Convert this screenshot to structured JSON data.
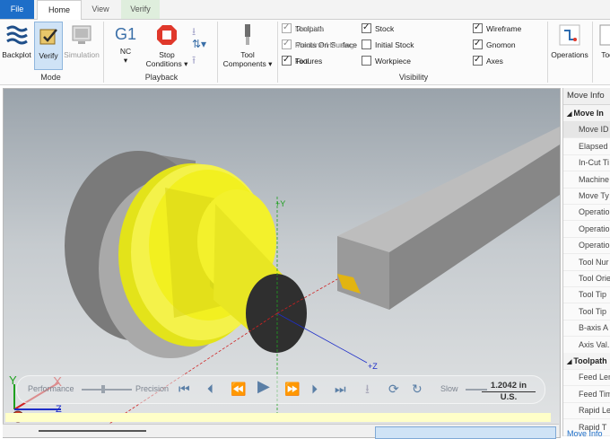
{
  "tabs": {
    "file": "File",
    "home": "Home",
    "view": "View",
    "verify": "Verify"
  },
  "ribbon": {
    "mode": {
      "label": "Mode",
      "backplot": "Backplot",
      "verify": "Verify",
      "simulation": "Simulation"
    },
    "playback": {
      "label": "Playback",
      "nc_glyph": "G1",
      "nc": "NC",
      "stop_conditions_1": "Stop",
      "stop_conditions_2": "Conditions"
    },
    "tool_components": {
      "line1": "Tool",
      "line2": "Components"
    },
    "visibility": {
      "label": "Visibility",
      "items": [
        {
          "label": "Toolpath",
          "checked": false,
          "enabled": true
        },
        {
          "label": "Points On Surface",
          "checked": false,
          "enabled": true
        },
        {
          "label": "Tool",
          "checked": true,
          "enabled": true
        },
        {
          "label": "Stock",
          "checked": true,
          "enabled": true
        },
        {
          "label": "Initial Stock",
          "checked": false,
          "enabled": true
        },
        {
          "label": "Workpiece",
          "checked": false,
          "enabled": true
        },
        {
          "label": "Wireframe",
          "checked": true,
          "enabled": true
        },
        {
          "label": "Gnomon",
          "checked": true,
          "enabled": true
        },
        {
          "label": "Axes",
          "checked": true,
          "enabled": true
        },
        {
          "label": "Machine",
          "checked": true,
          "enabled": false
        },
        {
          "label": "Machine Housing",
          "checked": true,
          "enabled": false
        },
        {
          "label": "Fixtures",
          "checked": true,
          "enabled": true
        }
      ]
    },
    "operations": "Operations",
    "tool_cut": "Tool"
  },
  "viewport": {
    "axis_y": "+Y",
    "axis_z": "+Z",
    "gnomon_y": "Y",
    "gnomon_x": "X",
    "gnomon_z": "Z"
  },
  "playback_bar": {
    "performance": "Performance",
    "precision": "Precision",
    "slow": "Slow",
    "distance": "1.2042 in",
    "units": "U.S."
  },
  "panel": {
    "title": "Move Info",
    "rows": [
      {
        "label": "Move In",
        "header": true
      },
      {
        "label": "Move ID",
        "header": false
      },
      {
        "label": "Elapsed",
        "header": false
      },
      {
        "label": "In-Cut Ti",
        "header": false
      },
      {
        "label": "Machine",
        "header": false
      },
      {
        "label": "Move Ty",
        "header": false
      },
      {
        "label": "Operatio",
        "header": false
      },
      {
        "label": "Operatio",
        "header": false
      },
      {
        "label": "Operatio",
        "header": false
      },
      {
        "label": "Tool Nur",
        "header": false
      },
      {
        "label": "Tool Orie",
        "header": false
      },
      {
        "label": "Tool Tip",
        "header": false
      },
      {
        "label": "Tool Tip",
        "header": false
      },
      {
        "label": "B-axis A",
        "header": false
      },
      {
        "label": "Axis Val.",
        "header": false
      },
      {
        "label": "Toolpath",
        "header": true
      },
      {
        "label": "Feed Len",
        "header": false
      },
      {
        "label": "Feed Tim",
        "header": false
      },
      {
        "label": "Rapid Le",
        "header": false
      },
      {
        "label": "Rapid T",
        "header": false
      }
    ],
    "footer_tab": "Move Info"
  },
  "colors": {
    "accent": "#1e6ec8",
    "stock": "#f2f020",
    "tool": "#9a9a9a"
  }
}
